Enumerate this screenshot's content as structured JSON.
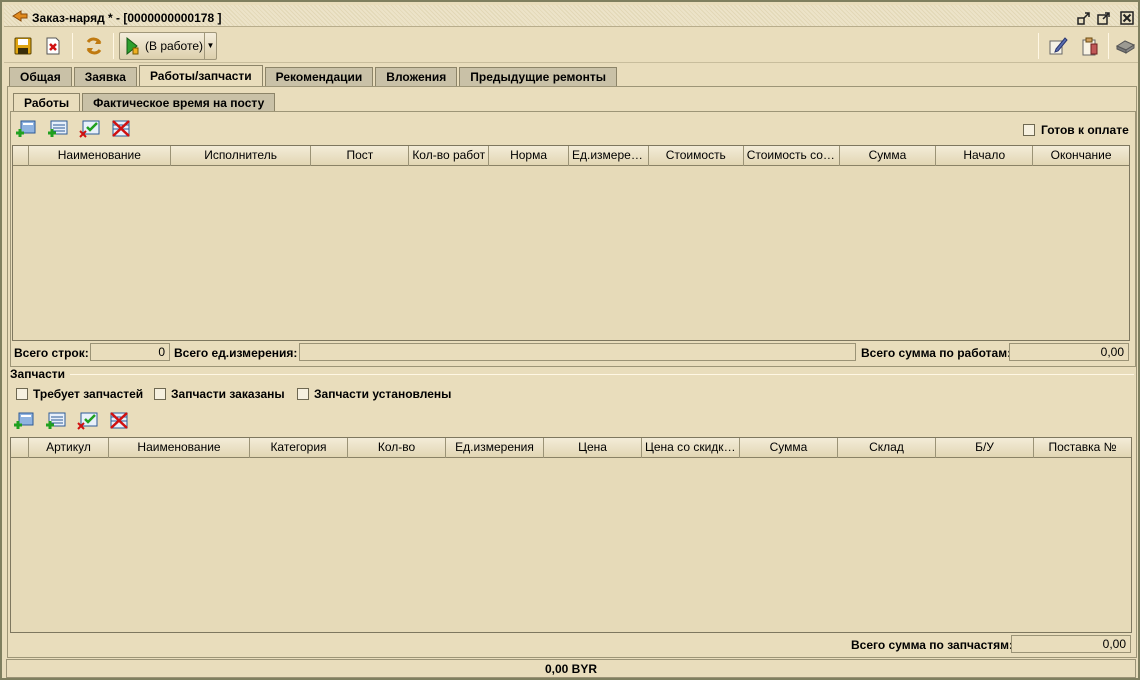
{
  "window": {
    "title": "Заказ-наряд * - [0000000000178 ]"
  },
  "toolbar": {
    "status_label": "(В работе)"
  },
  "tabs": [
    {
      "label": "Общая"
    },
    {
      "label": "Заявка"
    },
    {
      "label": "Работы/запчасти"
    },
    {
      "label": "Рекомендации"
    },
    {
      "label": "Вложения"
    },
    {
      "label": "Предыдущие ремонты"
    }
  ],
  "subtabs": [
    {
      "label": "Работы"
    },
    {
      "label": "Фактическое время на посту"
    }
  ],
  "works": {
    "ready_to_pay_label": "Готов к оплате",
    "columns": [
      "Наименование",
      "Исполнитель",
      "Пост",
      "Кол-во работ",
      "Норма",
      "Ед.измерен...",
      "Стоимость",
      "Стоимость со ...",
      "Сумма",
      "Начало",
      "Окончание"
    ],
    "total_rows_label": "Всего строк:",
    "total_rows_value": "0",
    "total_units_label": "Всего ед.измерения:",
    "total_units_value": "",
    "total_sum_label": "Всего сумма по работам:",
    "total_sum_value": "0,00"
  },
  "parts": {
    "section_title": "Запчасти",
    "needs_parts_label": "Требует запчастей",
    "parts_ordered_label": "Запчасти заказаны",
    "parts_installed_label": "Запчасти установлены",
    "columns": [
      "Артикул",
      "Наименование",
      "Категория",
      "Кол-во",
      "Ед.измерения",
      "Цена",
      "Цена со скидкой",
      "Сумма",
      "Склад",
      "Б/У",
      "Поставка №"
    ],
    "total_sum_label": "Всего сумма по запчастям:",
    "total_sum_value": "0,00"
  },
  "status_bar": {
    "total": "0,00 BYR"
  }
}
